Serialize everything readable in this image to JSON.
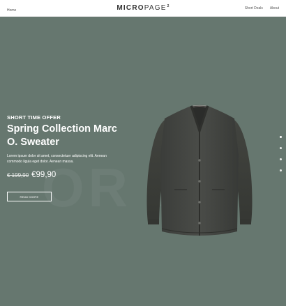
{
  "header": {
    "nav_left": {
      "home_label": "Home"
    },
    "logo": {
      "main": "MICRO",
      "sub": "PAGE",
      "sup": "2"
    },
    "nav_right": {
      "deals_label": "Short Deals",
      "about_label": "About"
    }
  },
  "hero": {
    "background_color": "#66776f",
    "watermark_text": "OR M",
    "offer_label": "SHORT TIME OFFER",
    "title": "Spring Collection Marc O. Sweater",
    "description": "Lorem ipsum dolor sit amet, consectetuer adipiscing elit. Aenean commodo ligula eget dolor. Aenean massa.",
    "price_old": "€ 199,90",
    "price_new": "€99,90",
    "read_more_label": "READ MORE",
    "product_image_icon": "cardigan-sweater",
    "pagination": {
      "total": 4,
      "active": 1
    }
  }
}
